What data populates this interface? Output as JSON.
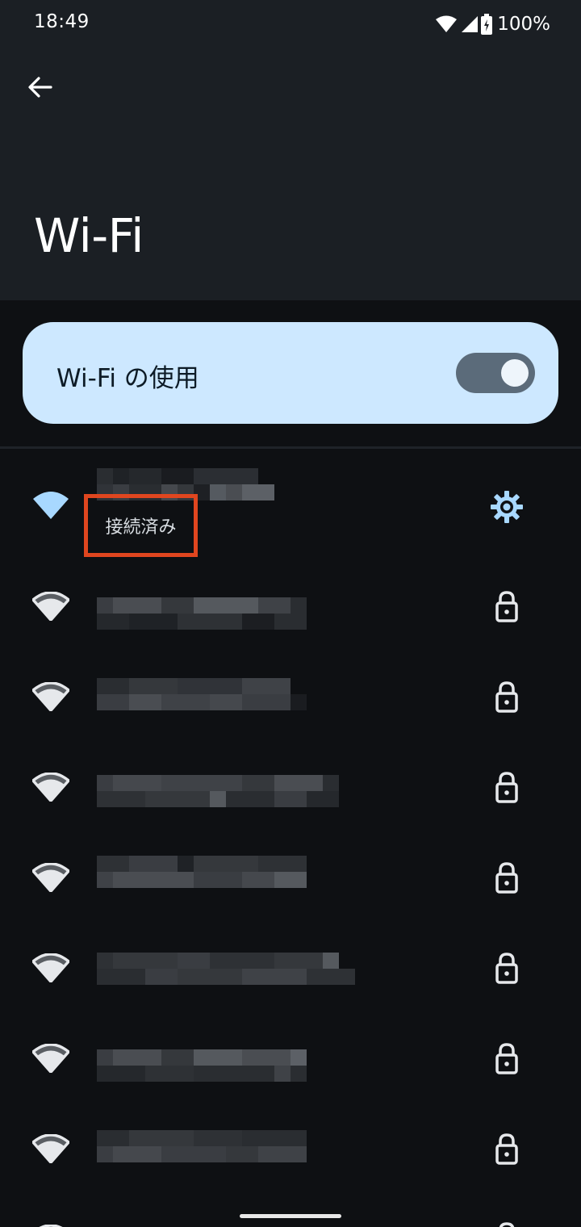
{
  "status_bar": {
    "time": "18:49",
    "battery": "100%"
  },
  "header": {
    "title": "Wi-Fi"
  },
  "master_toggle": {
    "label": "Wi-Fi の使用",
    "on": true
  },
  "connected_network": {
    "status": "接続済み",
    "ssid_pixelated": true
  },
  "networks": [
    {
      "secured": true,
      "ssid_pixelated": true
    },
    {
      "secured": true,
      "ssid_pixelated": true
    },
    {
      "secured": true,
      "ssid_pixelated": true
    },
    {
      "secured": true,
      "ssid_pixelated": true
    },
    {
      "secured": true,
      "ssid_pixelated": true
    },
    {
      "secured": true,
      "ssid_pixelated": true
    },
    {
      "secured": true,
      "ssid_pixelated": true
    }
  ],
  "colors": {
    "header_bg": "#1b1f24",
    "list_bg": "#0e1013",
    "toggle_card_bg": "#cde8ff",
    "connected_accent": "#a8d8ff",
    "highlight_box": "#e0461f"
  },
  "icons": {
    "back": "arrow-back-icon",
    "wifi": "wifi-signal-icon",
    "settings": "gear-icon",
    "lock": "lock-icon"
  }
}
